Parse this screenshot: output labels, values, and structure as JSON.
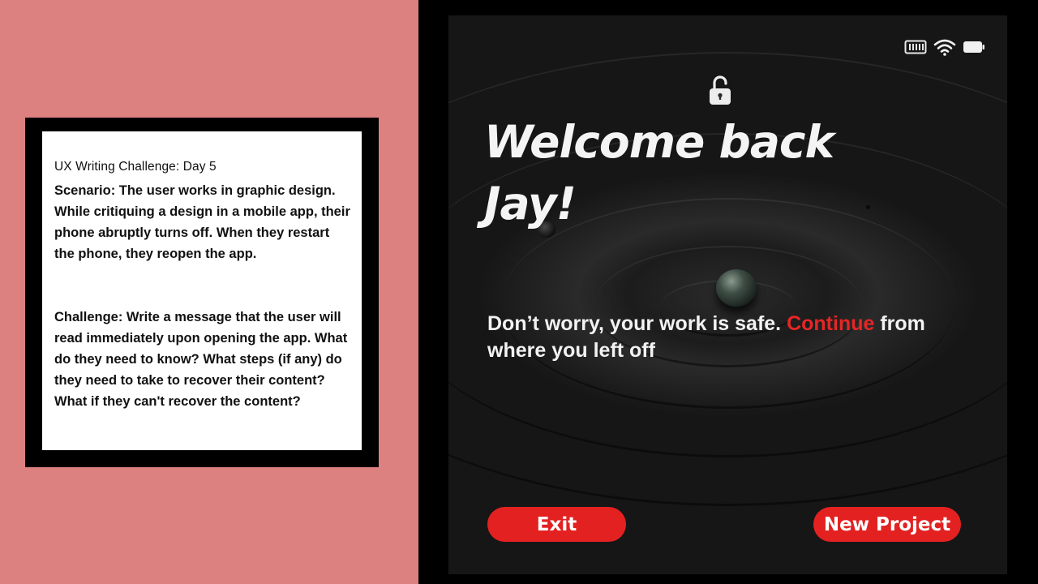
{
  "challenge_card": {
    "title": "UX Writing Challenge: Day 5",
    "scenario": "Scenario: The user works in graphic design. While critiquing a design in a mobile app, their phone abruptly turns off. When they restart the phone, they reopen the app.",
    "challenge": "Challenge: Write a message that the user will read immediately upon opening the app. What do they need to know? What steps (if any) do they need to take to recover their content? What if they can't recover the content?"
  },
  "status_bar": {
    "icons": [
      "battery-outline-icon",
      "wifi-icon",
      "battery-icon"
    ]
  },
  "lock_icon": "unlocked-padlock-icon",
  "welcome": {
    "line1": "Welcome back",
    "line2": "Jay!"
  },
  "message": {
    "prefix": "Don’t worry, your work is safe. ",
    "link": "Continue",
    "suffix": " from where you left off"
  },
  "buttons": {
    "exit": "Exit",
    "new_project": "New Project"
  },
  "colors": {
    "left_background": "#dd8080",
    "accent_red": "#e32121",
    "link_red": "#e52626",
    "frame_black": "#000000"
  }
}
